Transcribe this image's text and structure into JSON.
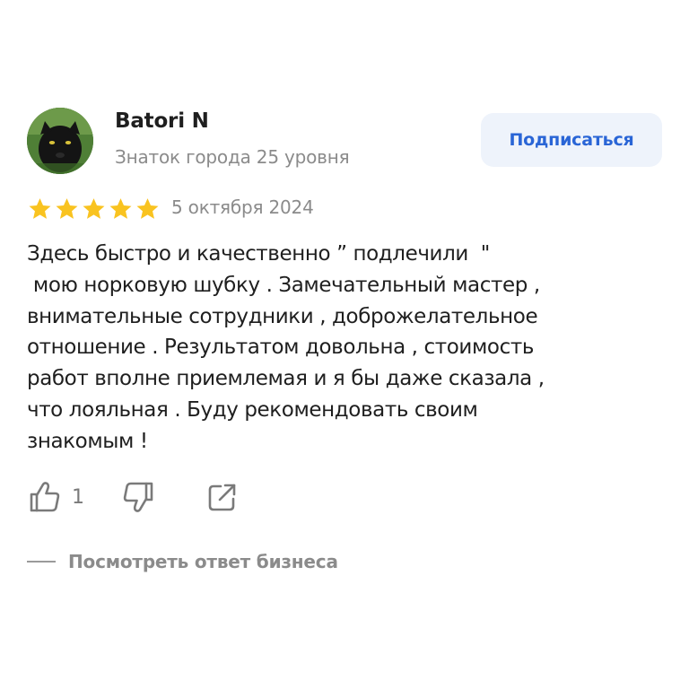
{
  "author": {
    "name": "Batori N",
    "level": "Знаток города 25 уровня",
    "avatar_icon": "panther-avatar"
  },
  "subscribe": {
    "label": "Подписаться"
  },
  "review": {
    "rating": 5,
    "max_rating": 5,
    "date": "5 октября 2024",
    "text_lines": [
      "Здесь быстро и качественно ” подлечили  \"",
      " мою норковую шубку . Замечательный мастер ,",
      "внимательные сотрудники , доброжелательное",
      "отношение . Результатом довольна , стоимость",
      "работ вполне приемлемая и я бы даже сказала ,",
      "что лояльная . Буду рекомендовать своим",
      "знакомым !"
    ]
  },
  "actions": {
    "like_count": "1",
    "like_icon": "thumbs-up-icon",
    "dislike_icon": "thumbs-down-icon",
    "share_icon": "share-icon"
  },
  "business_reply": {
    "label": "Посмотреть ответ бизнеса"
  },
  "colors": {
    "star": "#f9c320",
    "accent": "#2965d6",
    "button_bg": "#eef3fb",
    "muted_text": "#8b8b8b",
    "main_text": "#1f1f1f"
  }
}
